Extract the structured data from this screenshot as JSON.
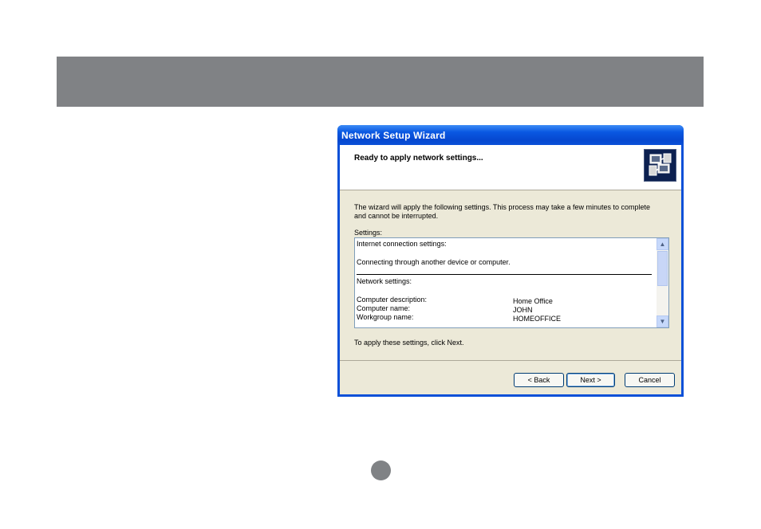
{
  "window": {
    "title": "Network Setup Wizard",
    "heading": "Ready to apply network settings...",
    "header_icon": "network-computers-icon"
  },
  "intro": {
    "line1": "The wizard will apply the following settings. This process may take a few minutes to complete",
    "line2": "and cannot be interrupted."
  },
  "settings": {
    "label": "Settings:",
    "internet_heading": "Internet connection settings:",
    "internet_value": "Connecting through another device or computer.",
    "network_heading": "Network settings:",
    "rows": [
      {
        "label": "Computer description:",
        "value": "Home Office"
      },
      {
        "label": "Computer name:",
        "value": "JOHN"
      },
      {
        "label": "Workgroup name:",
        "value": "HOMEOFFICE"
      }
    ]
  },
  "apply_hint": "To apply these settings, click Next.",
  "buttons": {
    "back": "< Back",
    "next": "Next >",
    "cancel": "Cancel"
  },
  "colors": {
    "banner": "#808285",
    "titlebar": "#0a50d8",
    "dialog_bg": "#ece9d8"
  }
}
